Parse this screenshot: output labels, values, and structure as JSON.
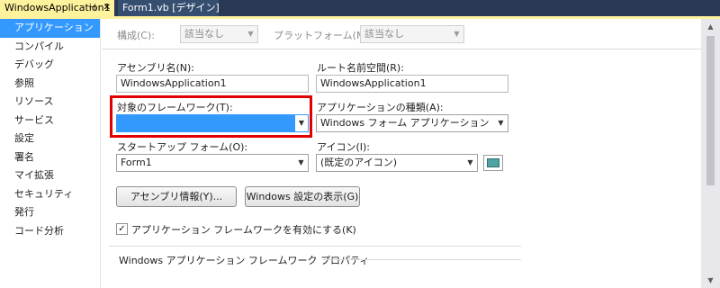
{
  "tabs": [
    {
      "label": "WindowsApplication1",
      "active": true,
      "icons": [
        "⊣",
        "✕"
      ]
    },
    {
      "label": "Form1.vb [デザイン]",
      "active": false
    }
  ],
  "nav": {
    "items": [
      {
        "label": "アプリケーション",
        "selected": true
      },
      {
        "label": "コンパイル"
      },
      {
        "label": "デバッグ"
      },
      {
        "label": "参照"
      },
      {
        "label": "リソース"
      },
      {
        "label": "サービス"
      },
      {
        "label": "設定"
      },
      {
        "label": "署名"
      },
      {
        "label": "マイ拡張"
      },
      {
        "label": "セキュリティ"
      },
      {
        "label": "発行"
      },
      {
        "label": "コード分析"
      }
    ]
  },
  "config": {
    "config_label": "構成(C):",
    "config_value": "該当なし",
    "platform_label": "プラットフォーム(M):",
    "platform_value": "該当なし"
  },
  "form": {
    "assembly_name_label": "アセンブリ名(N):",
    "assembly_name_value": "WindowsApplication1",
    "root_namespace_label": "ルート名前空間(R):",
    "root_namespace_value": "WindowsApplication1",
    "target_framework_label": "対象のフレームワーク(T):",
    "target_framework_value": "",
    "app_type_label": "アプリケーションの種類(A):",
    "app_type_value": "Windows フォーム アプリケーション",
    "startup_form_label": "スタートアップ フォーム(O):",
    "startup_form_value": "Form1",
    "icon_label": "アイコン(I):",
    "icon_value": "(既定のアイコン)"
  },
  "buttons": {
    "assembly_info": "アセンブリ情報(Y)...",
    "view_windows_settings": "Windows 設定の表示(G)"
  },
  "checkbox": {
    "enable_framework_label": "アプリケーション フレームワークを有効にする(K)",
    "enable_framework_checked": true,
    "check_glyph": "✓"
  },
  "group": {
    "title": "Windows アプリケーション フレームワーク プロパティ"
  },
  "icons": {
    "dropdown": "▼",
    "scroll_up": "▲",
    "scroll_down": "▼"
  },
  "colors": {
    "active_tab": "#fff29d",
    "selection": "#3399ff",
    "highlight_box": "#e00000",
    "chrome": "#293955"
  }
}
